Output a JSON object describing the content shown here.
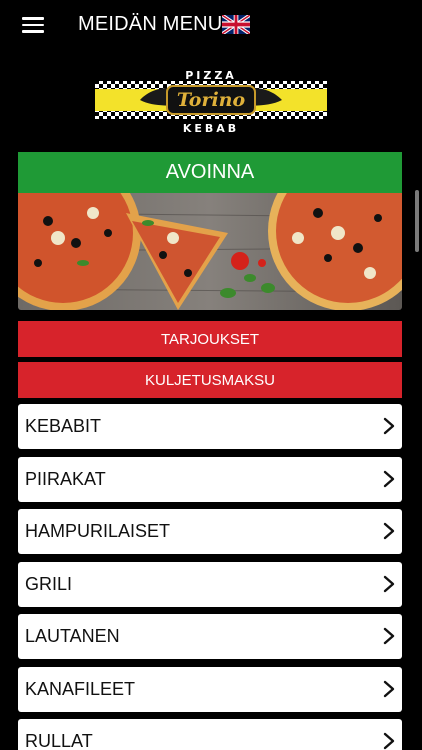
{
  "header": {
    "title": "MEIDÄN MENU",
    "menu_icon": "hamburger-menu-icon",
    "language_icon": "uk-flag-icon"
  },
  "logo": {
    "top_text": "PIZZA",
    "brand_text": "Torino",
    "bottom_text": "KEBAB"
  },
  "status": {
    "label": "AVOINNA",
    "color": "#1f9a36"
  },
  "hero_image": {
    "description_icon": "pizza-photo"
  },
  "actions": {
    "offers_label": "TARJOUKSET",
    "delivery_label": "KULJETUSMAKSU",
    "color": "#d7232b"
  },
  "categories": [
    {
      "label": "KEBABIT"
    },
    {
      "label": "PIIRAKAT"
    },
    {
      "label": "HAMPURILAISET"
    },
    {
      "label": "GRILI"
    },
    {
      "label": "LAUTANEN"
    },
    {
      "label": "KANAFILEET"
    },
    {
      "label": "RULLAT"
    }
  ]
}
